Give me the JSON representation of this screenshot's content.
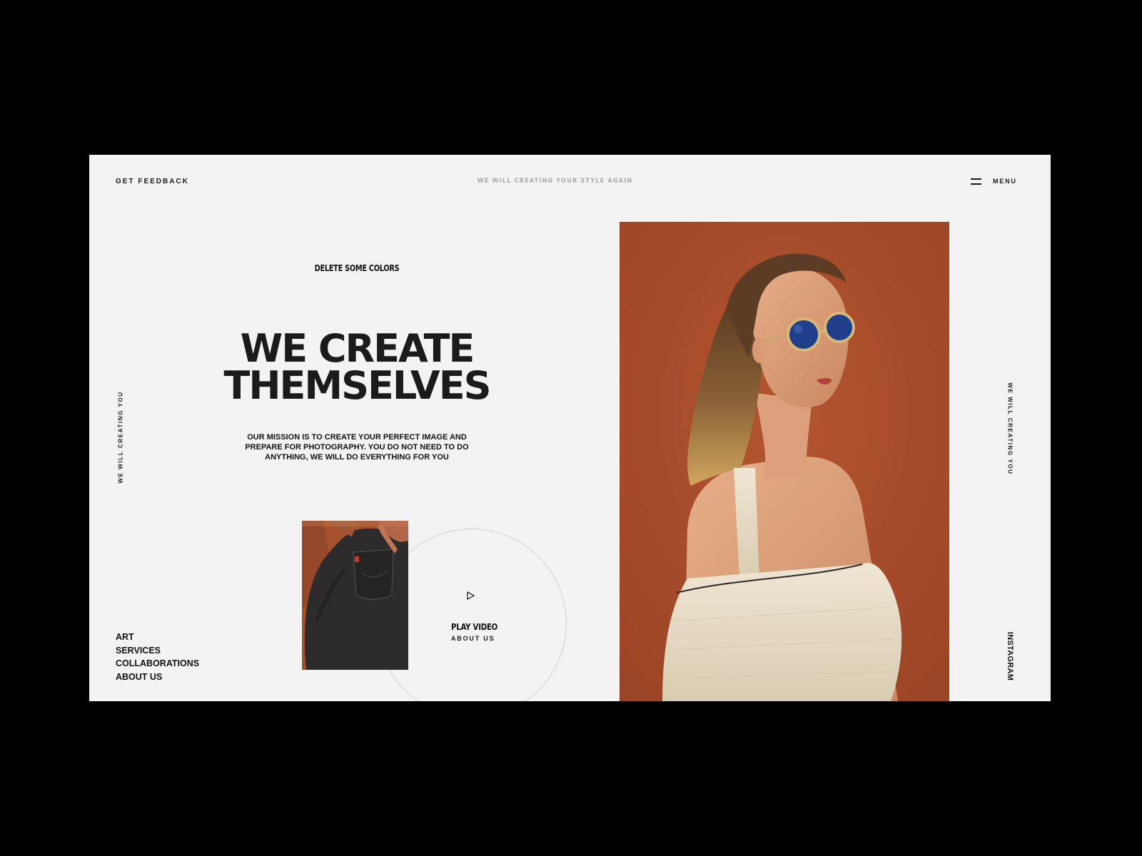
{
  "header": {
    "feedback_link": "GET FEEDBACK",
    "tagline": "WE WILL CREATING YOUR STYLE AGAIN",
    "menu_label": "MENU"
  },
  "side": {
    "left_vertical": "WE WILL CREATING YOU",
    "right_vertical": "WE WILL CREATING YOU",
    "instagram": "INSTAGRAM"
  },
  "hero": {
    "eyebrow": "DELETE SOME COLORS",
    "headline_line1": "WE CREATE",
    "headline_line2": "THEMSELVES",
    "mission": "OUR MISSION IS TO CREATE YOUR PERFECT IMAGE AND PREPARE FOR PHOTOGRAPHY. YOU DO NOT NEED TO DO ANYTHING, WE WILL DO EVERYTHING FOR YOU"
  },
  "video": {
    "play_label": "PLAY VIDEO",
    "about_label": "ABOUT US"
  },
  "nav": {
    "items": [
      {
        "label": "ART"
      },
      {
        "label": "SERVICES"
      },
      {
        "label": "COLLABORATIONS"
      },
      {
        "label": "ABOUT US"
      }
    ]
  },
  "images": {
    "main_photo": "woman-in-round-sunglasses-photo",
    "thumb_photo": "black-jeans-back-pocket-photo"
  },
  "colors": {
    "frame": "#000000",
    "page_background": "#f3f3f3",
    "text": "#111111",
    "accent_rust": "#a84c2a",
    "muted_text": "#a8a8a8"
  }
}
